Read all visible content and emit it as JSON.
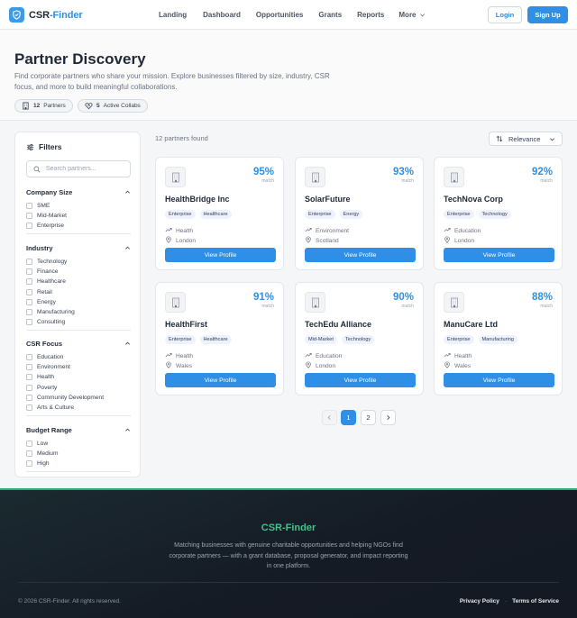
{
  "header": {
    "brand_prefix": "CSR",
    "brand_suffix": "-Finder",
    "nav": [
      "Landing",
      "Dashboard",
      "Opportunities",
      "Grants",
      "Reports"
    ],
    "nav_more": "More",
    "login": "Login",
    "signup": "Sign Up"
  },
  "hero": {
    "title": "Partner Discovery",
    "subtitle": "Find corporate partners who share your mission. Explore businesses filtered by size, industry, CSR focus, and more to build meaningful collaborations.",
    "stats": [
      {
        "value": "12",
        "label": "Partners",
        "icon": "building-icon"
      },
      {
        "value": "5",
        "label": "Active Collabs",
        "icon": "heart-handshake-icon"
      }
    ]
  },
  "filters": {
    "title": "Filters",
    "search_placeholder": "Search partners...",
    "groups": [
      {
        "title": "Company Size",
        "items": [
          "SME",
          "Mid-Market",
          "Enterprise"
        ]
      },
      {
        "title": "Industry",
        "items": [
          "Technology",
          "Finance",
          "Healthcare",
          "Retail",
          "Energy",
          "Manufacturing",
          "Consulting"
        ]
      },
      {
        "title": "CSR Focus",
        "items": [
          "Education",
          "Environment",
          "Health",
          "Poverty",
          "Community Development",
          "Arts & Culture"
        ]
      },
      {
        "title": "Budget Range",
        "items": [
          "Low",
          "Medium",
          "High"
        ]
      }
    ]
  },
  "results": {
    "count_text": "12 partners found",
    "sort_label": "Relevance",
    "match_label": "match",
    "view_label": "View Profile",
    "cards": [
      {
        "name": "HealthBridge Inc",
        "match": "95%",
        "tags": [
          "Enterprise",
          "Healthcare"
        ],
        "focus": "Health",
        "location": "London"
      },
      {
        "name": "SolarFuture",
        "match": "93%",
        "tags": [
          "Enterprise",
          "Energy"
        ],
        "focus": "Environment",
        "location": "Scotland"
      },
      {
        "name": "TechNova Corp",
        "match": "92%",
        "tags": [
          "Enterprise",
          "Technology"
        ],
        "focus": "Education",
        "location": "London"
      },
      {
        "name": "HealthFirst",
        "match": "91%",
        "tags": [
          "Enterprise",
          "Healthcare"
        ],
        "focus": "Health",
        "location": "Wales"
      },
      {
        "name": "TechEdu Alliance",
        "match": "90%",
        "tags": [
          "Mid-Market",
          "Technology"
        ],
        "focus": "Education",
        "location": "London"
      },
      {
        "name": "ManuCare Ltd",
        "match": "88%",
        "tags": [
          "Enterprise",
          "Manufacturing"
        ],
        "focus": "Health",
        "location": "Wales"
      }
    ]
  },
  "pagination": {
    "pages": [
      "1",
      "2"
    ],
    "current": "1"
  },
  "footer": {
    "brand": "CSR-Finder",
    "description": "Matching businesses with genuine charitable opportunities and helping NGOs find corporate partners — with a grant database, proposal generator, and impact reporting in one platform.",
    "copyright": "© 2026 CSR-Finder. All rights reserved.",
    "links": [
      "Privacy Policy",
      "Terms of Service"
    ],
    "separator": "·"
  },
  "colors": {
    "accent": "#2f8fe6",
    "footer_accent": "#3fc28a"
  }
}
